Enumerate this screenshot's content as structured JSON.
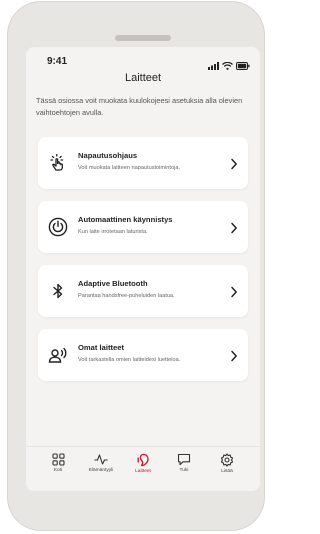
{
  "status": {
    "time": "9:41"
  },
  "header": {
    "title": "Laitteet"
  },
  "intro": "Tässä osiossa voit muokata kuulokojeesi asetuksia alla olevien vaihtoehtojen avulla.",
  "cards": [
    {
      "icon": "tap-hand-icon",
      "title": "Napautusohjaus",
      "subtitle": "Voit muokata laitteen napautustoimintoja."
    },
    {
      "icon": "power-icon",
      "title": "Automaattinen käynnistys",
      "subtitle": "Kun laite irrotetaan laturista."
    },
    {
      "icon": "bluetooth-icon",
      "title": "Adaptive Bluetooth",
      "subtitle": "Parantaa handsfree-puheluiden laatua."
    },
    {
      "icon": "person-sound-icon",
      "title": "Omat laitteet",
      "subtitle": "Voit tarkastella omien laitteidesi luetteloa."
    }
  ],
  "tabs": [
    {
      "icon": "grid-icon",
      "label": "Koti"
    },
    {
      "icon": "activity-icon",
      "label": "Elämäntyyli"
    },
    {
      "icon": "hearing-aid-icon",
      "label": "Laitteet",
      "active": true
    },
    {
      "icon": "chat-icon",
      "label": "Tuki"
    },
    {
      "icon": "gear-icon",
      "label": "Lisää"
    }
  ],
  "colors": {
    "accent": "#c8102e",
    "background": "#f4f3f1",
    "card": "#ffffff"
  }
}
